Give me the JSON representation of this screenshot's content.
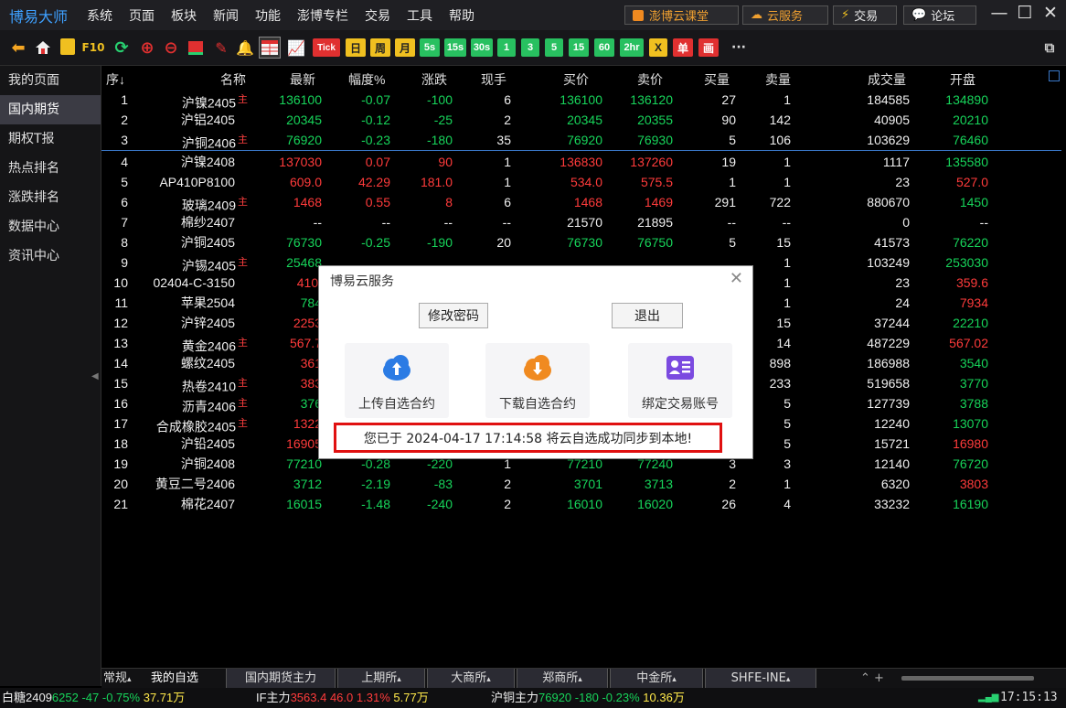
{
  "app": {
    "title": "博易大师"
  },
  "menu": [
    "系统",
    "页面",
    "板块",
    "新闻",
    "功能",
    "澎博专栏",
    "交易",
    "工具",
    "帮助"
  ],
  "header_links": {
    "classroom": "澎博云课堂",
    "cloud": "云服务",
    "trade": "交易",
    "forum": "论坛"
  },
  "window_buttons": {
    "minimize": "—",
    "maximize": "☐",
    "close": "✕"
  },
  "toolbar": {
    "f10": "F10",
    "tick": "Tick",
    "day": "日",
    "week": "周",
    "month": "月",
    "periods": [
      "5s",
      "15s",
      "30s",
      "1",
      "3",
      "5",
      "15",
      "60",
      "2hr"
    ],
    "x_label": "X",
    "single": "单",
    "draw": "画",
    "more": "···"
  },
  "sidebar": {
    "items": [
      "我的页面",
      "国内期货",
      "期权T报",
      "热点排名",
      "涨跌排名",
      "数据中心",
      "资讯中心"
    ],
    "active_index": 1
  },
  "columns": [
    "序↓",
    "名称",
    "最新",
    "幅度%",
    "涨跌",
    "现手",
    "买价",
    "卖价",
    "买量",
    "卖量",
    "成交量",
    "开盘"
  ],
  "rows": [
    {
      "seq": "1",
      "name": "沪镍2405",
      "mark": "主",
      "last": "136100",
      "pct": "-0.07",
      "chg": "-100",
      "vol": "6",
      "bid": "136100",
      "ask": "136120",
      "bidq": "27",
      "askq": "1",
      "total": "184585",
      "open": "134890",
      "dir": "d",
      "odir": "d"
    },
    {
      "seq": "2",
      "name": "沪铝2405",
      "mark": "",
      "last": "20345",
      "pct": "-0.12",
      "chg": "-25",
      "vol": "2",
      "bid": "20345",
      "ask": "20355",
      "bidq": "90",
      "askq": "142",
      "total": "40905",
      "open": "20210",
      "dir": "d",
      "odir": "d"
    },
    {
      "seq": "3",
      "name": "沪铜2406",
      "mark": "主",
      "last": "76920",
      "pct": "-0.23",
      "chg": "-180",
      "vol": "35",
      "bid": "76920",
      "ask": "76930",
      "bidq": "5",
      "askq": "106",
      "total": "103629",
      "open": "76460",
      "dir": "d",
      "odir": "d"
    },
    {
      "seq": "4",
      "name": "沪镍2408",
      "mark": "",
      "last": "137030",
      "pct": "0.07",
      "chg": "90",
      "vol": "1",
      "bid": "136830",
      "ask": "137260",
      "bidq": "19",
      "askq": "1",
      "total": "1117",
      "open": "135580",
      "dir": "u",
      "odir": "d"
    },
    {
      "seq": "5",
      "name": "AP410P8100",
      "mark": "",
      "last": "609.0",
      "pct": "42.29",
      "chg": "181.0",
      "vol": "1",
      "bid": "534.0",
      "ask": "575.5",
      "bidq": "1",
      "askq": "1",
      "total": "23",
      "open": "527.0",
      "dir": "u",
      "odir": "u"
    },
    {
      "seq": "6",
      "name": "玻璃2409",
      "mark": "主",
      "last": "1468",
      "pct": "0.55",
      "chg": "8",
      "vol": "6",
      "bid": "1468",
      "ask": "1469",
      "bidq": "291",
      "askq": "722",
      "total": "880670",
      "open": "1450",
      "dir": "u",
      "odir": "d"
    },
    {
      "seq": "7",
      "name": "棉纱2407",
      "mark": "",
      "last": "--",
      "pct": "--",
      "chg": "--",
      "vol": "--",
      "bid": "21570",
      "ask": "21895",
      "bidq": "--",
      "askq": "--",
      "total": "0",
      "open": "--",
      "dir": "n",
      "odir": "n"
    },
    {
      "seq": "8",
      "name": "沪铜2405",
      "mark": "",
      "last": "76730",
      "pct": "-0.25",
      "chg": "-190",
      "vol": "20",
      "bid": "76730",
      "ask": "76750",
      "bidq": "5",
      "askq": "15",
      "total": "41573",
      "open": "76220",
      "dir": "d",
      "odir": "d"
    },
    {
      "seq": "9",
      "name": "沪锡2405",
      "mark": "主",
      "last": "25468",
      "pct": "",
      "chg": "",
      "vol": "",
      "bid": "",
      "ask": "",
      "bidq": "",
      "askq": "1",
      "total": "103249",
      "open": "253030",
      "dir": "d",
      "odir": "d"
    },
    {
      "seq": "10",
      "name": "02404-C-3150",
      "mark": "",
      "last": "410.",
      "pct": "",
      "chg": "",
      "vol": "",
      "bid": "",
      "ask": "",
      "bidq": "",
      "askq": "1",
      "total": "23",
      "open": "359.6",
      "dir": "u",
      "odir": "u"
    },
    {
      "seq": "11",
      "name": "苹果2504",
      "mark": "",
      "last": "784",
      "pct": "",
      "chg": "",
      "vol": "",
      "bid": "",
      "ask": "",
      "bidq": "",
      "askq": "1",
      "total": "24",
      "open": "7934",
      "dir": "d",
      "odir": "u"
    },
    {
      "seq": "12",
      "name": "沪锌2405",
      "mark": "",
      "last": "2253",
      "pct": "",
      "chg": "",
      "vol": "",
      "bid": "",
      "ask": "",
      "bidq": "",
      "askq": "15",
      "total": "37244",
      "open": "22210",
      "dir": "u",
      "odir": "d"
    },
    {
      "seq": "13",
      "name": "黄金2406",
      "mark": "主",
      "last": "567.7",
      "pct": "",
      "chg": "",
      "vol": "",
      "bid": "",
      "ask": "",
      "bidq": "",
      "askq": "14",
      "total": "487229",
      "open": "567.02",
      "dir": "u",
      "odir": "u"
    },
    {
      "seq": "14",
      "name": "螺纹2405",
      "mark": "",
      "last": "361",
      "pct": "",
      "chg": "",
      "vol": "",
      "bid": "",
      "ask": "",
      "bidq": "",
      "askq": "898",
      "total": "186988",
      "open": "3540",
      "dir": "u",
      "odir": "d"
    },
    {
      "seq": "15",
      "name": "热卷2410",
      "mark": "主",
      "last": "383",
      "pct": "",
      "chg": "",
      "vol": "",
      "bid": "",
      "ask": "",
      "bidq": "",
      "askq": "233",
      "total": "519658",
      "open": "3770",
      "dir": "u",
      "odir": "d"
    },
    {
      "seq": "16",
      "name": "沥青2406",
      "mark": "主",
      "last": "376",
      "pct": "",
      "chg": "",
      "vol": "",
      "bid": "",
      "ask": "",
      "bidq": "",
      "askq": "5",
      "total": "127739",
      "open": "3788",
      "dir": "d",
      "odir": "d"
    },
    {
      "seq": "17",
      "name": "合成橡胶2405",
      "mark": "主",
      "last": "1322",
      "pct": "",
      "chg": "",
      "vol": "",
      "bid": "",
      "ask": "",
      "bidq": "",
      "askq": "5",
      "total": "12240",
      "open": "13070",
      "dir": "u",
      "odir": "d"
    },
    {
      "seq": "18",
      "name": "沪铅2405",
      "mark": "",
      "last": "16905",
      "pct": "0.30",
      "chg": "50",
      "vol": "1",
      "bid": "16905",
      "ask": "16910",
      "bidq": "1",
      "askq": "5",
      "total": "15721",
      "open": "16980",
      "dir": "u",
      "odir": "u"
    },
    {
      "seq": "19",
      "name": "沪铜2408",
      "mark": "",
      "last": "77210",
      "pct": "-0.28",
      "chg": "-220",
      "vol": "1",
      "bid": "77210",
      "ask": "77240",
      "bidq": "3",
      "askq": "3",
      "total": "12140",
      "open": "76720",
      "dir": "d",
      "odir": "d"
    },
    {
      "seq": "20",
      "name": "黄豆二号2406",
      "mark": "",
      "last": "3712",
      "pct": "-2.19",
      "chg": "-83",
      "vol": "2",
      "bid": "3701",
      "ask": "3713",
      "bidq": "2",
      "askq": "1",
      "total": "6320",
      "open": "3803",
      "dir": "d",
      "odir": "u"
    },
    {
      "seq": "21",
      "name": "棉花2407",
      "mark": "",
      "last": "16015",
      "pct": "-1.48",
      "chg": "-240",
      "vol": "2",
      "bid": "16010",
      "ask": "16020",
      "bidq": "26",
      "askq": "4",
      "total": "33232",
      "open": "16190",
      "dir": "d",
      "odir": "d"
    }
  ],
  "popup": {
    "title": "博易云服务",
    "close": "✕",
    "change_password": "修改密码",
    "logout": "退出",
    "upload": "上传自选合约",
    "download": "下载自选合约",
    "bind": "绑定交易账号",
    "message": "您已于 2024-04-17 17:14:58 将云自选成功同步到本地!"
  },
  "tabs": [
    "常规",
    "我的自选",
    "国内期货主力",
    "上期所",
    "大商所",
    "郑商所",
    "中金所",
    "SHFE-INE"
  ],
  "ticker": {
    "items": [
      {
        "name": "白糖2409",
        "price": "6252",
        "chg": "-47",
        "pct": "-0.75%",
        "vol": "37.71万"
      },
      {
        "name": "IF主力",
        "price": "3563.4",
        "chg": "46.0",
        "pct": "1.31%",
        "vol": "5.77万"
      },
      {
        "name": "沪铜主力",
        "price": "76920",
        "chg": "-180",
        "pct": "-0.23%",
        "vol": "10.36万"
      }
    ],
    "time": "17:15:13"
  },
  "colors": {
    "up": "#ff3b3b",
    "down": "#17d45a",
    "accent": "#3ea0ff",
    "highlight": "#e01010"
  }
}
